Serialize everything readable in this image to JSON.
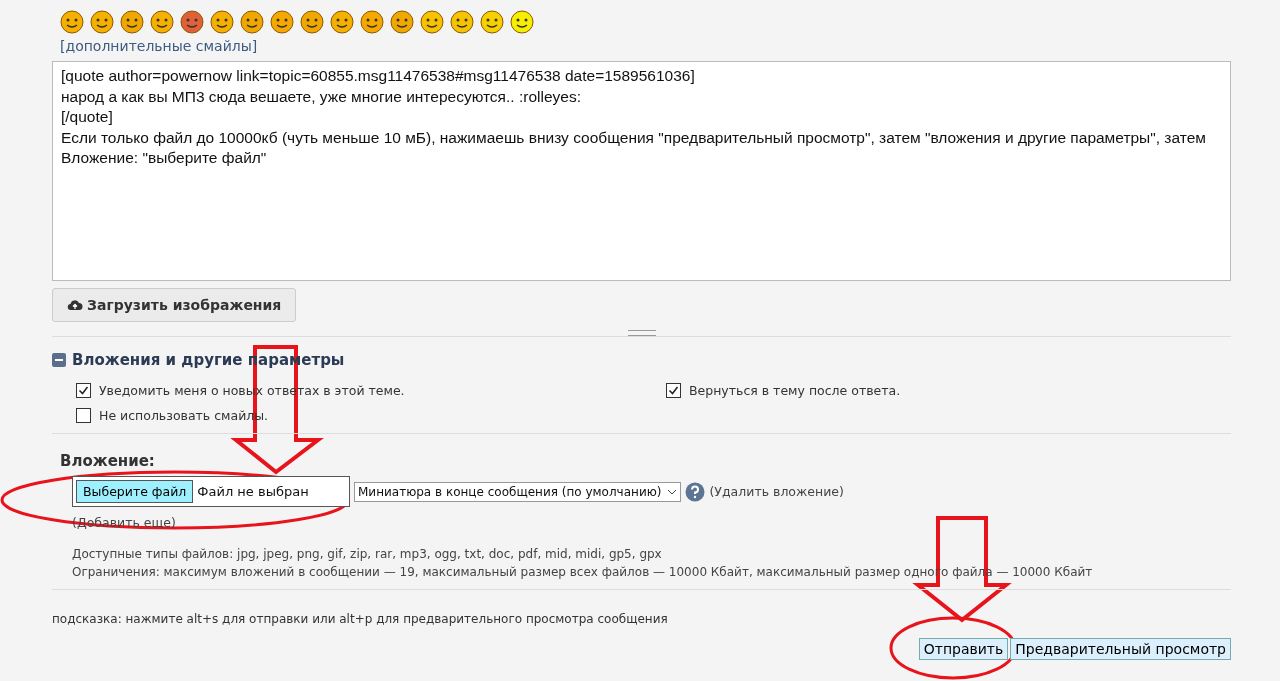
{
  "more_smileys_link": "[дополнительные смайлы]",
  "message_lines": [
    "[quote author=powernow link=topic=60855.msg11476538#msg11476538 date=1589561036]",
    "народ а как вы МП3 сюда вешаете, уже многие интересуются..  :rolleyes:",
    "[/quote]",
    "Если только файл до 10000кб (чуть меньше 10 мБ), нажимаешь внизу сообщения \"предварительный просмотр\", затем \"вложения и другие параметры\", затем Вложение: \"выберите файл\""
  ],
  "upload_button": "Загрузить изображения",
  "options_section": {
    "title": "Вложения и другие параметры",
    "expanded": true,
    "options": [
      {
        "label": "Уведомить меня о новых ответах в этой теме.",
        "checked": true
      },
      {
        "label": "Вернуться в тему после ответа.",
        "checked": true
      },
      {
        "label": "Не использовать смайлы.",
        "checked": false
      }
    ]
  },
  "attachment": {
    "label": "Вложение:",
    "choose_button": "Выберите файл",
    "file_status": "Файл не выбран",
    "placement_select": "Миниатюра в конце сообщения (по умолчанию)",
    "remove_link": "(Удалить вложение)",
    "add_more_link": "(Добавить еще)",
    "allowed_types": "Доступные типы файлов: jpg, jpeg, png, gif, zip, rar, mp3, ogg, txt, doc, pdf, mid, midi, gp5, gpx",
    "limits": "Ограничения: максимум вложений в сообщении — 19, максимальный размер всех файлов — 10000 Кбайт, максимальный размер одного файла — 10000 Кбайт"
  },
  "hint": "подсказка: нажмите alt+s для отправки или alt+p для предварительного просмотра сообщения",
  "buttons": [
    "Отправить",
    "Предварительный просмотр"
  ]
}
